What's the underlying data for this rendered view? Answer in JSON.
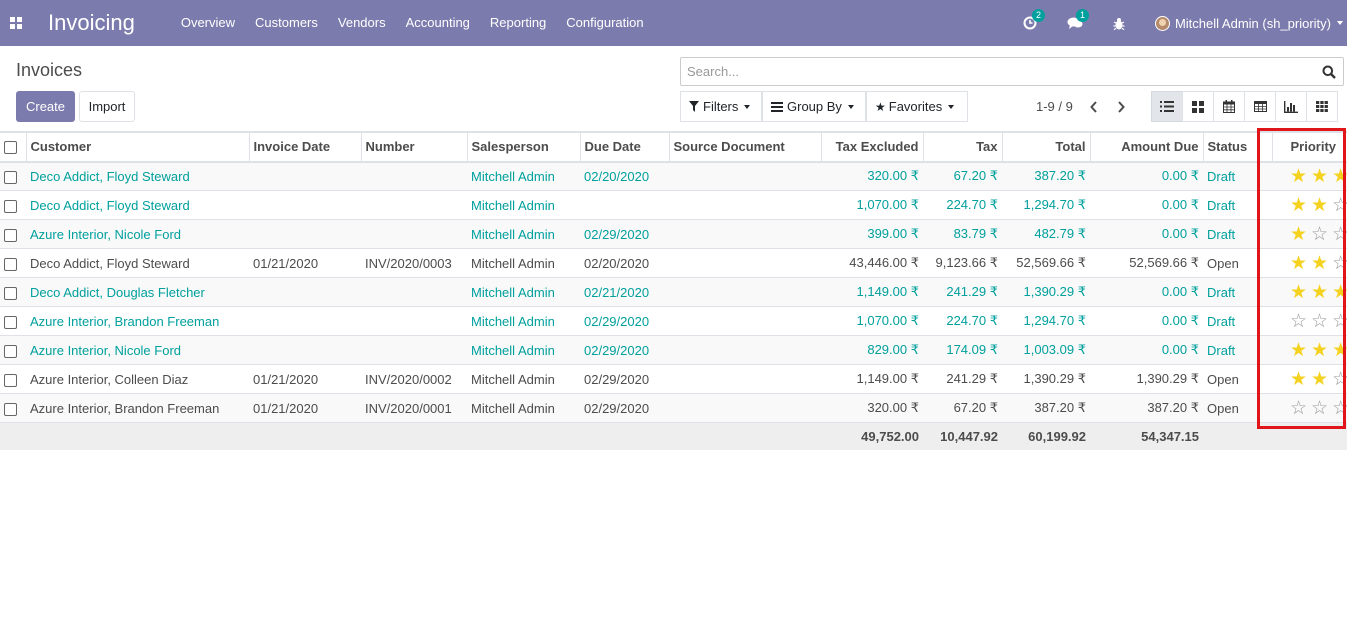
{
  "app": {
    "title": "Invoicing"
  },
  "menu": [
    "Overview",
    "Customers",
    "Vendors",
    "Accounting",
    "Reporting",
    "Configuration"
  ],
  "systray": {
    "activity_count": "2",
    "messages_count": "1",
    "user_name": "Mitchell Admin (sh_priority)"
  },
  "page": {
    "breadcrumb": "Invoices",
    "create_label": "Create",
    "import_label": "Import"
  },
  "search": {
    "placeholder": "Search..."
  },
  "filters": {
    "filters_label": "Filters",
    "groupby_label": "Group By",
    "favorites_label": "Favorites"
  },
  "pager": {
    "value": "1-9 / 9"
  },
  "views": [
    "list-view-icon",
    "kanban-view-icon",
    "calendar-view-icon",
    "pivot-view-icon",
    "graph-view-icon",
    "grid-view-icon"
  ],
  "table": {
    "columns": [
      "Customer",
      "Invoice Date",
      "Number",
      "Salesperson",
      "Due Date",
      "Source Document",
      "Tax Excluded",
      "Tax",
      "Total",
      "Amount Due",
      "Status",
      "Priority"
    ],
    "rows": [
      {
        "customer": "Deco Addict, Floyd Steward",
        "invoice_date": "",
        "number": "",
        "salesperson": "Mitchell Admin",
        "due_date": "02/20/2020",
        "source": "",
        "tax_excluded": "320.00 ₹",
        "tax": "67.20 ₹",
        "total": "387.20 ₹",
        "amount_due": "0.00 ₹",
        "status": "Draft",
        "priority": 3
      },
      {
        "customer": "Deco Addict, Floyd Steward",
        "invoice_date": "",
        "number": "",
        "salesperson": "Mitchell Admin",
        "due_date": "",
        "source": "",
        "tax_excluded": "1,070.00 ₹",
        "tax": "224.70 ₹",
        "total": "1,294.70 ₹",
        "amount_due": "0.00 ₹",
        "status": "Draft",
        "priority": 2
      },
      {
        "customer": "Azure Interior, Nicole Ford",
        "invoice_date": "",
        "number": "",
        "salesperson": "Mitchell Admin",
        "due_date": "02/29/2020",
        "source": "",
        "tax_excluded": "399.00 ₹",
        "tax": "83.79 ₹",
        "total": "482.79 ₹",
        "amount_due": "0.00 ₹",
        "status": "Draft",
        "priority": 1
      },
      {
        "customer": "Deco Addict, Floyd Steward",
        "invoice_date": "01/21/2020",
        "number": "INV/2020/0003",
        "salesperson": "Mitchell Admin",
        "due_date": "02/20/2020",
        "source": "",
        "tax_excluded": "43,446.00 ₹",
        "tax": "9,123.66 ₹",
        "total": "52,569.66 ₹",
        "amount_due": "52,569.66 ₹",
        "status": "Open",
        "priority": 2
      },
      {
        "customer": "Deco Addict, Douglas Fletcher",
        "invoice_date": "",
        "number": "",
        "salesperson": "Mitchell Admin",
        "due_date": "02/21/2020",
        "source": "",
        "tax_excluded": "1,149.00 ₹",
        "tax": "241.29 ₹",
        "total": "1,390.29 ₹",
        "amount_due": "0.00 ₹",
        "status": "Draft",
        "priority": 3
      },
      {
        "customer": "Azure Interior, Brandon Freeman",
        "invoice_date": "",
        "number": "",
        "salesperson": "Mitchell Admin",
        "due_date": "02/29/2020",
        "source": "",
        "tax_excluded": "1,070.00 ₹",
        "tax": "224.70 ₹",
        "total": "1,294.70 ₹",
        "amount_due": "0.00 ₹",
        "status": "Draft",
        "priority": 0
      },
      {
        "customer": "Azure Interior, Nicole Ford",
        "invoice_date": "",
        "number": "",
        "salesperson": "Mitchell Admin",
        "due_date": "02/29/2020",
        "source": "",
        "tax_excluded": "829.00 ₹",
        "tax": "174.09 ₹",
        "total": "1,003.09 ₹",
        "amount_due": "0.00 ₹",
        "status": "Draft",
        "priority": 3
      },
      {
        "customer": "Azure Interior, Colleen Diaz",
        "invoice_date": "01/21/2020",
        "number": "INV/2020/0002",
        "salesperson": "Mitchell Admin",
        "due_date": "02/29/2020",
        "source": "",
        "tax_excluded": "1,149.00 ₹",
        "tax": "241.29 ₹",
        "total": "1,390.29 ₹",
        "amount_due": "1,390.29 ₹",
        "status": "Open",
        "priority": 2
      },
      {
        "customer": "Azure Interior, Brandon Freeman",
        "invoice_date": "01/21/2020",
        "number": "INV/2020/0001",
        "salesperson": "Mitchell Admin",
        "due_date": "02/29/2020",
        "source": "",
        "tax_excluded": "320.00 ₹",
        "tax": "67.20 ₹",
        "total": "387.20 ₹",
        "amount_due": "387.20 ₹",
        "status": "Open",
        "priority": 0
      }
    ],
    "totals": {
      "tax_excluded": "49,752.00",
      "tax": "10,447.92",
      "total": "60,199.92",
      "amount_due": "54,347.15"
    }
  },
  "colors": {
    "navbar": "#7c7bad",
    "link": "#00a09d",
    "star_on": "#f4d21f",
    "highlight": "#e0151a"
  }
}
